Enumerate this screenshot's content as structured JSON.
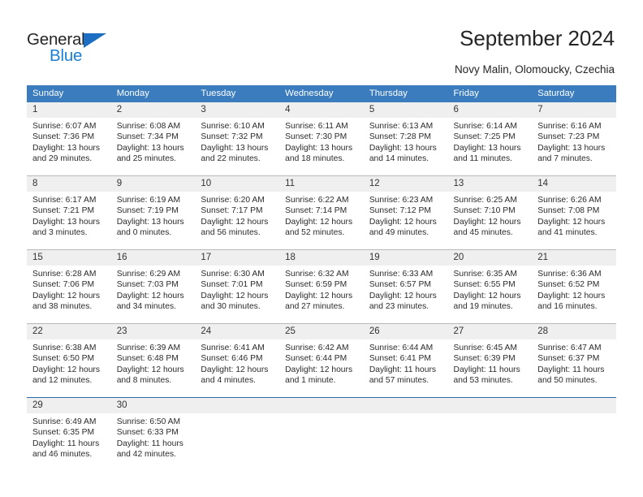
{
  "brand": {
    "name_top": "General",
    "name_bottom": "Blue",
    "triangle_color": "#1b6ec2",
    "top_color": "#262626",
    "bottom_color": "#1b7fd4"
  },
  "header": {
    "title": "September 2024",
    "subtitle": "Novy Malin, Olomoucky, Czechia"
  },
  "theme": {
    "header_bg": "#3a7cbd",
    "header_text": "#ffffff",
    "daynum_bg": "#efefef",
    "divider": "#b9b9b9",
    "last_row_divider": "#2a6aa8",
    "body_text": "#2b2b2b"
  },
  "weekdays": [
    "Sunday",
    "Monday",
    "Tuesday",
    "Wednesday",
    "Thursday",
    "Friday",
    "Saturday"
  ],
  "labels": {
    "sunrise": "Sunrise:",
    "sunset": "Sunset:",
    "daylight": "Daylight:"
  },
  "weeks": [
    [
      {
        "day": "1",
        "sunrise": "Sunrise: 6:07 AM",
        "sunset": "Sunset: 7:36 PM",
        "daylight": "Daylight: 13 hours and 29 minutes."
      },
      {
        "day": "2",
        "sunrise": "Sunrise: 6:08 AM",
        "sunset": "Sunset: 7:34 PM",
        "daylight": "Daylight: 13 hours and 25 minutes."
      },
      {
        "day": "3",
        "sunrise": "Sunrise: 6:10 AM",
        "sunset": "Sunset: 7:32 PM",
        "daylight": "Daylight: 13 hours and 22 minutes."
      },
      {
        "day": "4",
        "sunrise": "Sunrise: 6:11 AM",
        "sunset": "Sunset: 7:30 PM",
        "daylight": "Daylight: 13 hours and 18 minutes."
      },
      {
        "day": "5",
        "sunrise": "Sunrise: 6:13 AM",
        "sunset": "Sunset: 7:28 PM",
        "daylight": "Daylight: 13 hours and 14 minutes."
      },
      {
        "day": "6",
        "sunrise": "Sunrise: 6:14 AM",
        "sunset": "Sunset: 7:25 PM",
        "daylight": "Daylight: 13 hours and 11 minutes."
      },
      {
        "day": "7",
        "sunrise": "Sunrise: 6:16 AM",
        "sunset": "Sunset: 7:23 PM",
        "daylight": "Daylight: 13 hours and 7 minutes."
      }
    ],
    [
      {
        "day": "8",
        "sunrise": "Sunrise: 6:17 AM",
        "sunset": "Sunset: 7:21 PM",
        "daylight": "Daylight: 13 hours and 3 minutes."
      },
      {
        "day": "9",
        "sunrise": "Sunrise: 6:19 AM",
        "sunset": "Sunset: 7:19 PM",
        "daylight": "Daylight: 13 hours and 0 minutes."
      },
      {
        "day": "10",
        "sunrise": "Sunrise: 6:20 AM",
        "sunset": "Sunset: 7:17 PM",
        "daylight": "Daylight: 12 hours and 56 minutes."
      },
      {
        "day": "11",
        "sunrise": "Sunrise: 6:22 AM",
        "sunset": "Sunset: 7:14 PM",
        "daylight": "Daylight: 12 hours and 52 minutes."
      },
      {
        "day": "12",
        "sunrise": "Sunrise: 6:23 AM",
        "sunset": "Sunset: 7:12 PM",
        "daylight": "Daylight: 12 hours and 49 minutes."
      },
      {
        "day": "13",
        "sunrise": "Sunrise: 6:25 AM",
        "sunset": "Sunset: 7:10 PM",
        "daylight": "Daylight: 12 hours and 45 minutes."
      },
      {
        "day": "14",
        "sunrise": "Sunrise: 6:26 AM",
        "sunset": "Sunset: 7:08 PM",
        "daylight": "Daylight: 12 hours and 41 minutes."
      }
    ],
    [
      {
        "day": "15",
        "sunrise": "Sunrise: 6:28 AM",
        "sunset": "Sunset: 7:06 PM",
        "daylight": "Daylight: 12 hours and 38 minutes."
      },
      {
        "day": "16",
        "sunrise": "Sunrise: 6:29 AM",
        "sunset": "Sunset: 7:03 PM",
        "daylight": "Daylight: 12 hours and 34 minutes."
      },
      {
        "day": "17",
        "sunrise": "Sunrise: 6:30 AM",
        "sunset": "Sunset: 7:01 PM",
        "daylight": "Daylight: 12 hours and 30 minutes."
      },
      {
        "day": "18",
        "sunrise": "Sunrise: 6:32 AM",
        "sunset": "Sunset: 6:59 PM",
        "daylight": "Daylight: 12 hours and 27 minutes."
      },
      {
        "day": "19",
        "sunrise": "Sunrise: 6:33 AM",
        "sunset": "Sunset: 6:57 PM",
        "daylight": "Daylight: 12 hours and 23 minutes."
      },
      {
        "day": "20",
        "sunrise": "Sunrise: 6:35 AM",
        "sunset": "Sunset: 6:55 PM",
        "daylight": "Daylight: 12 hours and 19 minutes."
      },
      {
        "day": "21",
        "sunrise": "Sunrise: 6:36 AM",
        "sunset": "Sunset: 6:52 PM",
        "daylight": "Daylight: 12 hours and 16 minutes."
      }
    ],
    [
      {
        "day": "22",
        "sunrise": "Sunrise: 6:38 AM",
        "sunset": "Sunset: 6:50 PM",
        "daylight": "Daylight: 12 hours and 12 minutes."
      },
      {
        "day": "23",
        "sunrise": "Sunrise: 6:39 AM",
        "sunset": "Sunset: 6:48 PM",
        "daylight": "Daylight: 12 hours and 8 minutes."
      },
      {
        "day": "24",
        "sunrise": "Sunrise: 6:41 AM",
        "sunset": "Sunset: 6:46 PM",
        "daylight": "Daylight: 12 hours and 4 minutes."
      },
      {
        "day": "25",
        "sunrise": "Sunrise: 6:42 AM",
        "sunset": "Sunset: 6:44 PM",
        "daylight": "Daylight: 12 hours and 1 minute."
      },
      {
        "day": "26",
        "sunrise": "Sunrise: 6:44 AM",
        "sunset": "Sunset: 6:41 PM",
        "daylight": "Daylight: 11 hours and 57 minutes."
      },
      {
        "day": "27",
        "sunrise": "Sunrise: 6:45 AM",
        "sunset": "Sunset: 6:39 PM",
        "daylight": "Daylight: 11 hours and 53 minutes."
      },
      {
        "day": "28",
        "sunrise": "Sunrise: 6:47 AM",
        "sunset": "Sunset: 6:37 PM",
        "daylight": "Daylight: 11 hours and 50 minutes."
      }
    ],
    [
      {
        "day": "29",
        "sunrise": "Sunrise: 6:49 AM",
        "sunset": "Sunset: 6:35 PM",
        "daylight": "Daylight: 11 hours and 46 minutes."
      },
      {
        "day": "30",
        "sunrise": "Sunrise: 6:50 AM",
        "sunset": "Sunset: 6:33 PM",
        "daylight": "Daylight: 11 hours and 42 minutes."
      },
      {
        "day": "",
        "sunrise": "",
        "sunset": "",
        "daylight": ""
      },
      {
        "day": "",
        "sunrise": "",
        "sunset": "",
        "daylight": ""
      },
      {
        "day": "",
        "sunrise": "",
        "sunset": "",
        "daylight": ""
      },
      {
        "day": "",
        "sunrise": "",
        "sunset": "",
        "daylight": ""
      },
      {
        "day": "",
        "sunrise": "",
        "sunset": "",
        "daylight": ""
      }
    ]
  ]
}
